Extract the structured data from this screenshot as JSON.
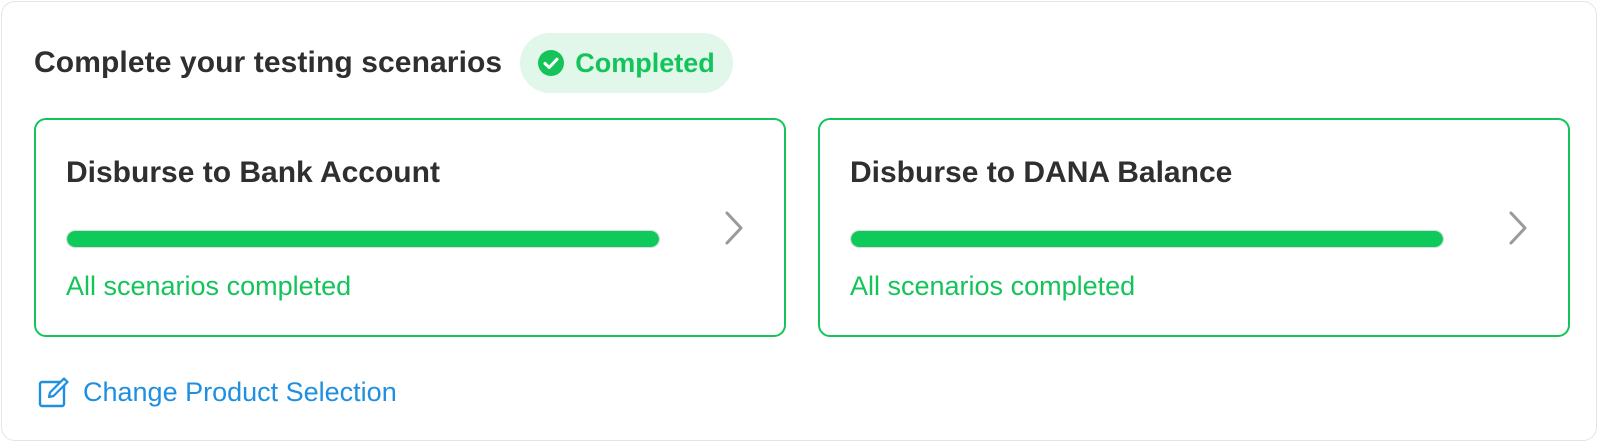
{
  "header": {
    "title": "Complete your testing scenarios",
    "badge_label": "Completed"
  },
  "cards": [
    {
      "title": "Disburse to Bank Account",
      "progress_percent": 100,
      "status": "All scenarios completed"
    },
    {
      "title": "Disburse to DANA Balance",
      "progress_percent": 100,
      "status": "All scenarios completed"
    }
  ],
  "footer": {
    "change_link_label": "Change Product Selection"
  },
  "colors": {
    "success_green": "#14c45a",
    "progress_fill": "#0dca5b",
    "badge_background": "#e0f7ea",
    "link_blue": "#1f8fe0",
    "text_dark": "#2f2f2f"
  },
  "icons": {
    "badge": "check-circle-icon",
    "card_arrow": "chevron-right-icon",
    "change_link": "edit-icon"
  }
}
